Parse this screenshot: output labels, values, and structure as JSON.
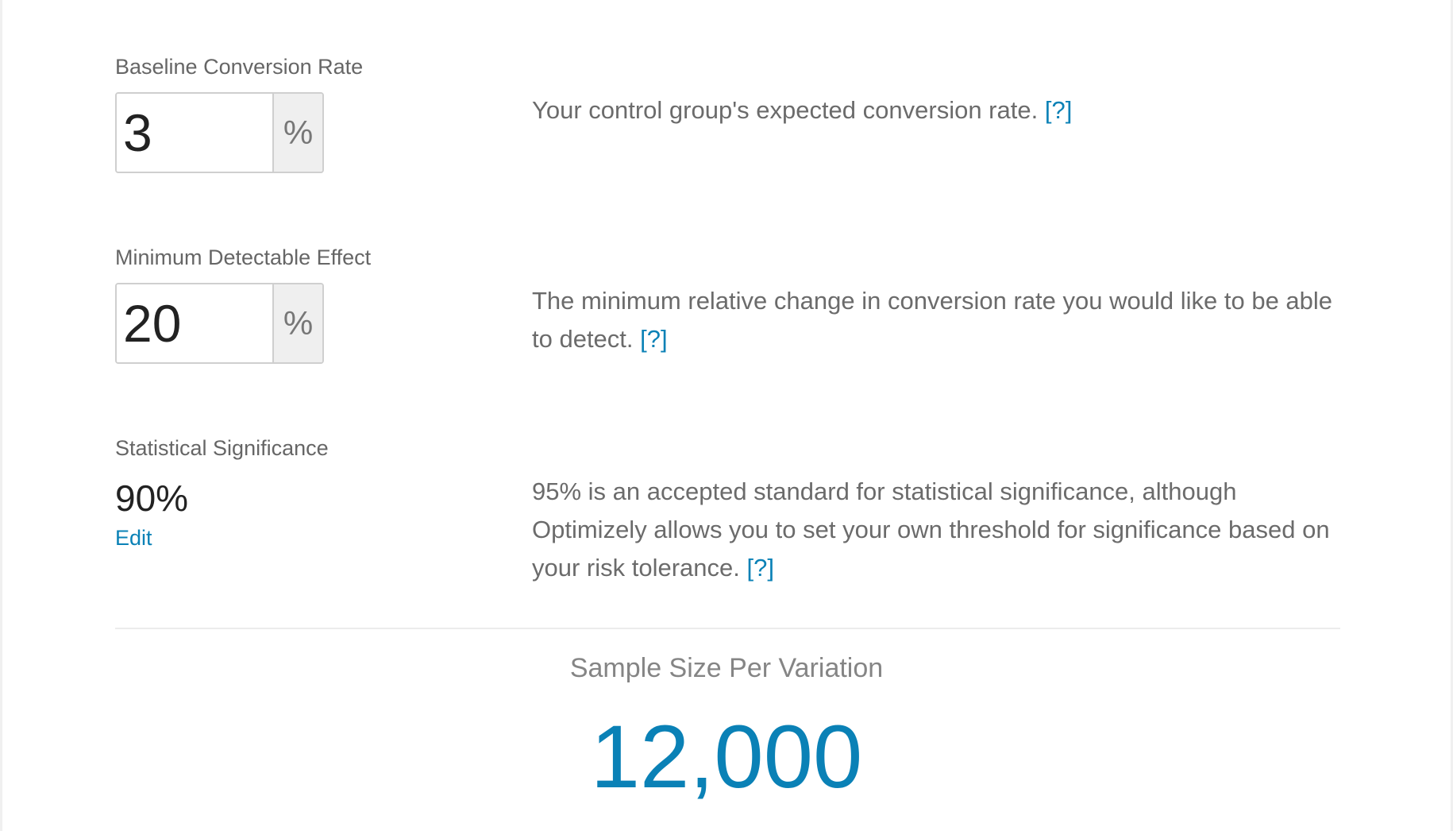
{
  "baseline": {
    "label": "Baseline Conversion Rate",
    "value": "3",
    "unit": "%",
    "help_text": "Your control group's expected conversion rate.",
    "help_link": "[?]"
  },
  "mde": {
    "label": "Minimum Detectable Effect",
    "value": "20",
    "unit": "%",
    "help_text": "The minimum relative change in conversion rate you would like to be able to detect.",
    "help_link": "[?]"
  },
  "significance": {
    "label": "Statistical Significance",
    "value": "90%",
    "edit_label": "Edit",
    "help_text": "95% is an accepted standard for statistical significance, although Optimizely allows you to set your own threshold for significance based on your risk tolerance.",
    "help_link": "[?]"
  },
  "result": {
    "label": "Sample Size Per Variation",
    "value": "12,000"
  },
  "colors": {
    "accent": "#0a81b6",
    "label_text": "#666666",
    "value_text": "#222222"
  }
}
